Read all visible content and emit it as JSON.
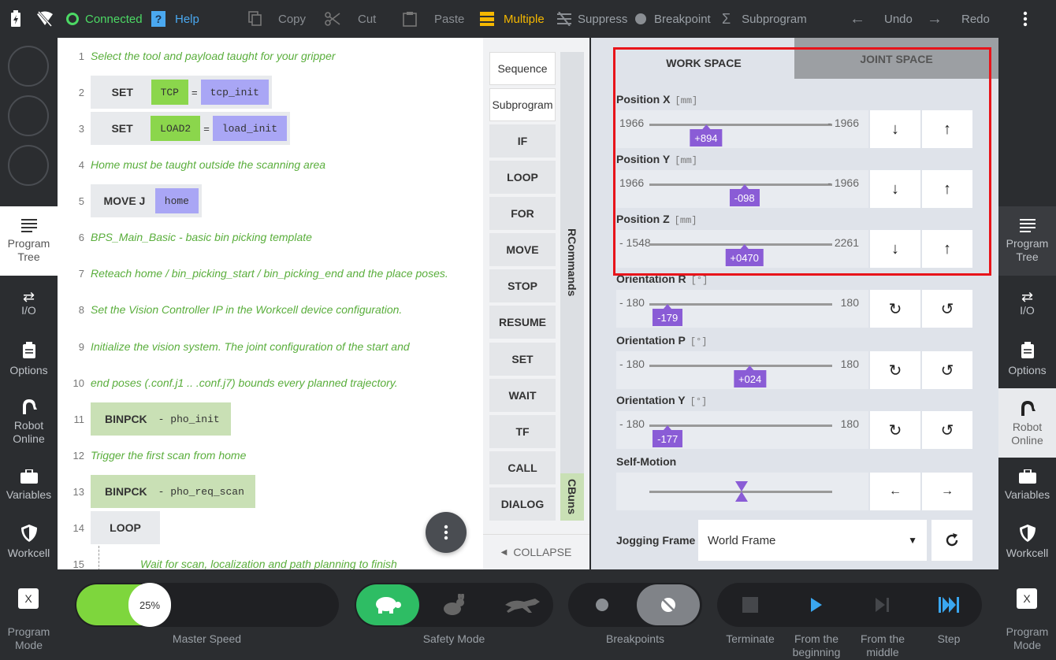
{
  "topbar": {
    "connected": "Connected",
    "help": "Help",
    "copy": "Copy",
    "cut": "Cut",
    "paste": "Paste",
    "multiple": "Multiple",
    "suppress": "Suppress",
    "breakpoint": "Breakpoint",
    "subprogram": "Subprogram",
    "undo": "Undo",
    "redo": "Redo",
    "accent": "#f5b800",
    "connected_color": "#4cd964"
  },
  "left_nav": {
    "items": [
      {
        "label": "Program\nTree",
        "icon": "list-icon"
      },
      {
        "label": "I/O",
        "icon": "io-arrows-icon"
      },
      {
        "label": "Options",
        "icon": "clipboard-icon"
      },
      {
        "label": "Robot\nOnline",
        "icon": "robot-arm-icon"
      },
      {
        "label": "Variables",
        "icon": "briefcase-icon"
      },
      {
        "label": "Workcell",
        "icon": "shield-icon"
      }
    ]
  },
  "program": {
    "lines": [
      {
        "n": "1",
        "comment": "Select the tool and payload taught for your gripper"
      },
      {
        "n": "2",
        "cmd": "SET",
        "var": "TCP",
        "eq": "=",
        "val": "tcp_init"
      },
      {
        "n": "3",
        "cmd": "SET",
        "var": "LOAD2",
        "eq": "=",
        "val": "load_init"
      },
      {
        "n": "4",
        "comment": "Home must be taught outside the scanning area"
      },
      {
        "n": "5",
        "cmd": "MOVE J",
        "val": "home"
      },
      {
        "n": "6",
        "comment": "BPS_Main_Basic - basic bin picking template"
      },
      {
        "n": "7",
        "comment": "Reteach home / bin_picking_start / bin_picking_end and the place poses."
      },
      {
        "n": "8",
        "comment": "Set the Vision Controller IP in the Workcell device configuration."
      },
      {
        "n": "9",
        "comment": "Initialize the vision system. The joint configuration of the start and"
      },
      {
        "n": "10",
        "comment": "end poses (.conf.j1 .. .conf.j7) bounds every planned trajectory."
      },
      {
        "n": "11",
        "cmd": "BINPCK",
        "arg": "- pho_init"
      },
      {
        "n": "12",
        "comment": "Trigger the first scan from home"
      },
      {
        "n": "13",
        "cmd": "BINPCK",
        "arg": "- pho_req_scan"
      },
      {
        "n": "14",
        "cmd": "LOOP"
      },
      {
        "n": "15",
        "comment": "Wait for scan, localization and path planning to finish"
      }
    ]
  },
  "commands": {
    "buttons": [
      "Sequence",
      "Subprogram",
      "IF",
      "LOOP",
      "FOR",
      "MOVE",
      "STOP",
      "RESUME",
      "SET",
      "WAIT",
      "TF",
      "CALL",
      "DIALOG"
    ],
    "rcommands": "RCommands",
    "cbuns": "CBuns",
    "collapse": "COLLAPSE"
  },
  "jog": {
    "tab_work": "WORK SPACE",
    "tab_joint": "JOINT SPACE",
    "axes": [
      {
        "label": "Position X",
        "unit": "[mm]",
        "min": "1966",
        "max": "- 1966",
        "value": "+894",
        "frac": 0.31,
        "dec": "↓",
        "inc": "↑"
      },
      {
        "label": "Position Y",
        "unit": "[mm]",
        "min": "1966",
        "max": "- 1966",
        "value": "-098",
        "frac": 0.52,
        "dec": "↓",
        "inc": "↑"
      },
      {
        "label": "Position Z",
        "unit": "[mm]",
        "min": "- 1548",
        "max": "2261",
        "value": "+0470",
        "frac": 0.52,
        "dec": "↓",
        "inc": "↑"
      },
      {
        "label": "Orientation R",
        "unit": "[°]",
        "min": "- 180",
        "max": "180",
        "value": "-179",
        "frac": 0.1,
        "dec": "↻",
        "inc": "↺"
      },
      {
        "label": "Orientation P",
        "unit": "[°]",
        "min": "- 180",
        "max": "180",
        "value": "+024",
        "frac": 0.55,
        "dec": "↻",
        "inc": "↺"
      },
      {
        "label": "Orientation Y",
        "unit": "[°]",
        "min": "- 180",
        "max": "180",
        "value": "-177",
        "frac": 0.1,
        "dec": "↻",
        "inc": "↺"
      }
    ],
    "self_motion": "Self-Motion",
    "self_left": "←",
    "self_right": "→",
    "frame_label": "Jogging Frame",
    "frame_value": "World Frame",
    "thumb_color": "#8a5cd6"
  },
  "bottom": {
    "program_mode": "Program\nMode",
    "mode_key": "X",
    "speed": "25%",
    "speed_label": "Master Speed",
    "safety_label": "Safety Mode",
    "breakpoints_label": "Breakpoints",
    "terminate": "Terminate",
    "from_beginning": "From the\nbeginning",
    "from_middle": "From the\nmiddle",
    "step": "Step"
  }
}
